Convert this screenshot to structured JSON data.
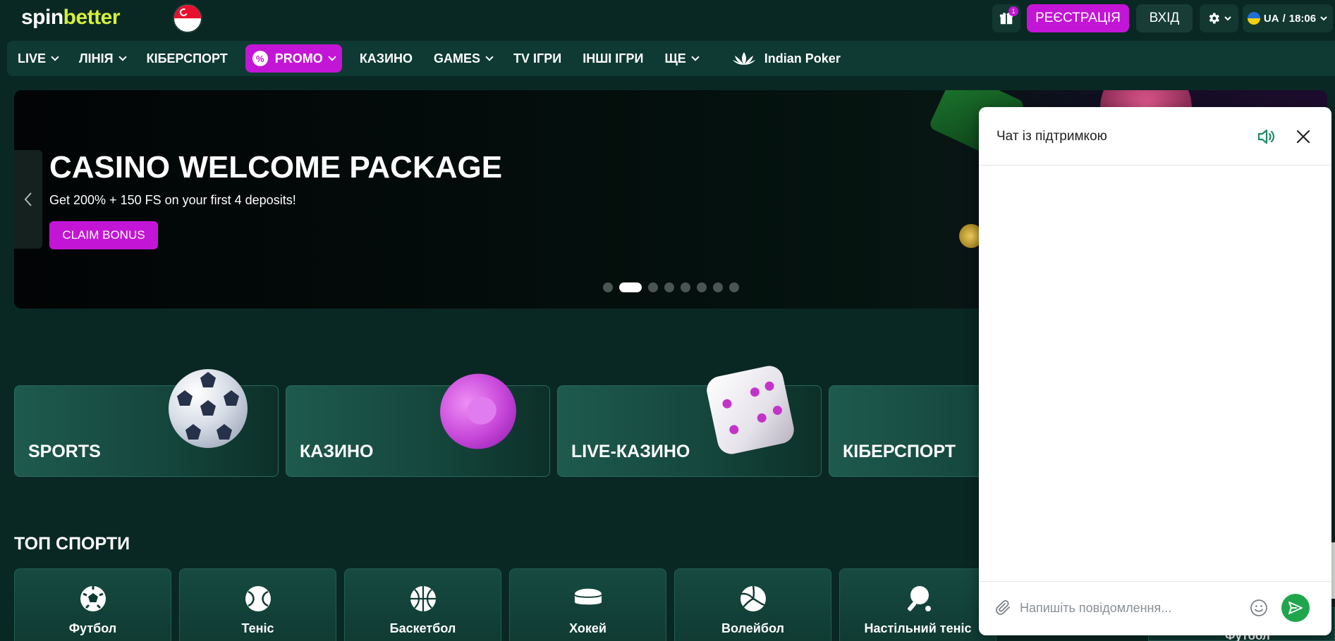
{
  "header": {
    "logo_spin": "spin",
    "logo_better": "better",
    "gift_badge": "1",
    "register_label": "РЕЄСТРАЦІЯ",
    "login_label": "ВХІД",
    "language": "UA",
    "time_separator": "/",
    "time": "18:06"
  },
  "nav": {
    "items": [
      {
        "label": "LIVE"
      },
      {
        "label": "ЛІНІЯ"
      },
      {
        "label": "КІБЕРСПОРТ"
      },
      {
        "label": "PROMO"
      },
      {
        "label": "КАЗИНО"
      },
      {
        "label": "GAMES"
      },
      {
        "label": "TV ІГРИ"
      },
      {
        "label": "ІНШІ ІГРИ"
      },
      {
        "label": "ЩЕ"
      },
      {
        "label": "Indian Poker"
      }
    ],
    "promo_icon_glyph": "%"
  },
  "banner": {
    "title": "CASINO WELCOME PACKAGE",
    "subtitle": "Get 200% + 150 FS on your first 4 deposits!",
    "cta_label": "CLAIM BONUS",
    "slide_count": 8,
    "active_slide": 2
  },
  "categories": [
    {
      "label": "SPORTS",
      "icon": "soccer-ball-icon"
    },
    {
      "label": "КАЗИНО",
      "icon": "casino-chip-icon"
    },
    {
      "label": "LIVE-КАЗИНО",
      "icon": "dice-icon"
    },
    {
      "label": "КІБЕРСПОРТ",
      "icon": "esports-icon"
    }
  ],
  "top_sports": {
    "title": "ТОП СПОРТИ",
    "items": [
      {
        "label": "Футбол",
        "icon": "football-icon"
      },
      {
        "label": "Теніс",
        "icon": "tennis-icon"
      },
      {
        "label": "Баскетбол",
        "icon": "basketball-icon"
      },
      {
        "label": "Хокей",
        "icon": "hockey-puck-icon"
      },
      {
        "label": "Волейбол",
        "icon": "volleyball-icon"
      },
      {
        "label": "Настільний теніс",
        "icon": "table-tennis-icon"
      }
    ],
    "peek_label": "Футбол"
  },
  "chat": {
    "title": "Чат із підтримкою",
    "input_placeholder": "Напишіть повідомлення..."
  },
  "colors": {
    "background": "#0a2823",
    "accent": "#c315d6",
    "brand_green": "#d6f03a",
    "send_green": "#1fa64d"
  }
}
